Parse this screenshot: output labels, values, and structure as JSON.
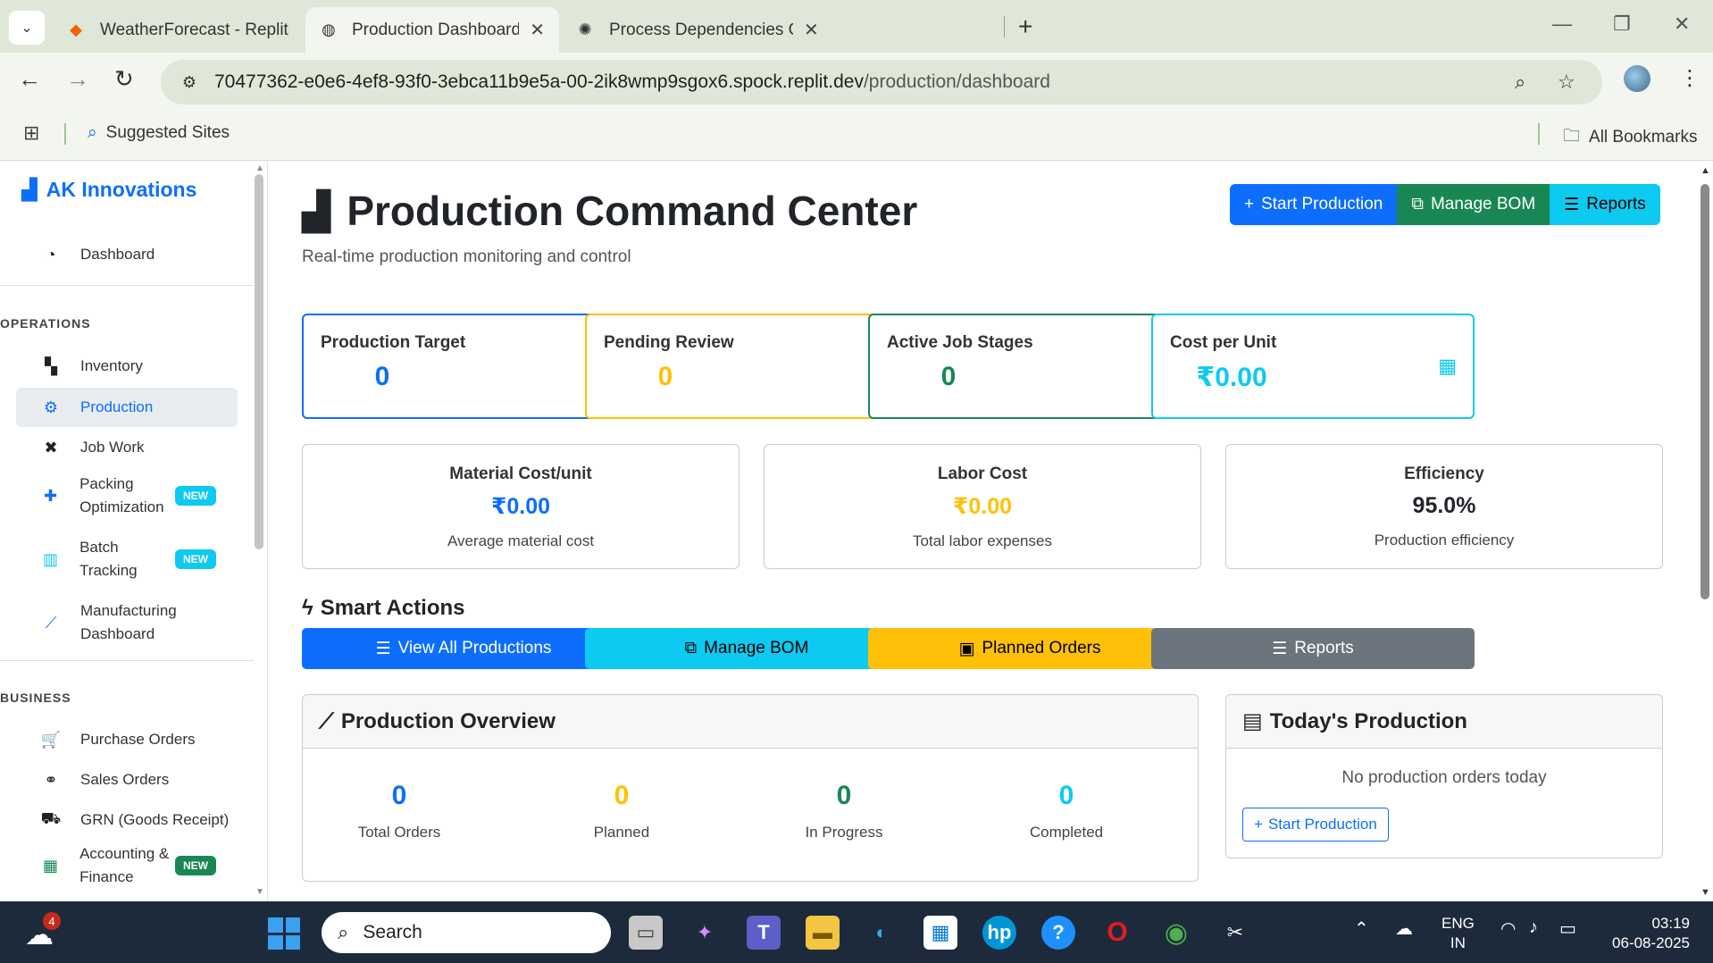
{
  "browser": {
    "tabs": [
      {
        "title": "WeatherForecast - Replit",
        "active": false
      },
      {
        "title": "Production Dashboard - Factory",
        "active": true
      },
      {
        "title": "Process Dependencies Overview",
        "active": false
      }
    ],
    "url_host": "70477362-e0e6-4ef8-93f0-3ebca11b9e5a-00-2ik8wmp9sgox6.spock.replit.dev",
    "url_path": "/production/dashboard",
    "bookmarks": {
      "suggested": "Suggested Sites",
      "all": "All Bookmarks"
    }
  },
  "sidebar": {
    "brand": "AK Innovations",
    "dashboard": "Dashboard",
    "section_operations": "OPERATIONS",
    "operations": [
      {
        "label": "Inventory",
        "icon": "cubes-icon"
      },
      {
        "label": "Production",
        "icon": "gears-icon",
        "active": true
      },
      {
        "label": "Job Work",
        "icon": "tools-icon"
      },
      {
        "label": "Packing Optimization",
        "icon": "puzzle-icon",
        "badge": "NEW"
      },
      {
        "label": "Batch Tracking",
        "icon": "barcode-icon",
        "badge": "NEW"
      },
      {
        "label": "Manufacturing Dashboard",
        "icon": "chart-line-icon"
      }
    ],
    "section_business": "BUSINESS",
    "business": [
      {
        "label": "Purchase Orders",
        "icon": "cart-icon"
      },
      {
        "label": "Sales Orders",
        "icon": "handshake-icon"
      },
      {
        "label": "GRN (Goods Receipt)",
        "icon": "truck-icon"
      },
      {
        "label": "Accounting & Finance",
        "icon": "calculator-icon",
        "badge": "NEW"
      }
    ]
  },
  "header": {
    "title": "Production Command Center",
    "subtitle": "Real-time production monitoring and control",
    "buttons": {
      "start": "Start Production",
      "bom": "Manage BOM",
      "reports": "Reports"
    }
  },
  "stats": [
    {
      "label": "Production Target",
      "value": "0",
      "color": "#0d6efd"
    },
    {
      "label": "Pending Review",
      "value": "0",
      "color": "#ffc107"
    },
    {
      "label": "Active Job Stages",
      "value": "0",
      "color": "#198754"
    },
    {
      "label": "Cost per Unit",
      "value": "₹0.00",
      "color": "#0dcaf0"
    }
  ],
  "costs": [
    {
      "label": "Material Cost/unit",
      "value": "₹0.00",
      "desc": "Average material cost",
      "color": "#0d6efd"
    },
    {
      "label": "Labor Cost",
      "value": "₹0.00",
      "desc": "Total labor expenses",
      "color": "#ffc107"
    },
    {
      "label": "Efficiency",
      "value": "95.0%",
      "desc": "Production efficiency",
      "color": "#212529"
    }
  ],
  "smart_actions": {
    "title": "Smart Actions",
    "buttons": [
      "View All Productions",
      "Manage BOM",
      "Planned Orders",
      "Reports"
    ]
  },
  "overview": {
    "title": "Production Overview",
    "stats": [
      {
        "value": "0",
        "label": "Total Orders",
        "color": "#0d6efd"
      },
      {
        "value": "0",
        "label": "Planned",
        "color": "#ffc107"
      },
      {
        "value": "0",
        "label": "In Progress",
        "color": "#198754"
      },
      {
        "value": "0",
        "label": "Completed",
        "color": "#0dcaf0"
      }
    ]
  },
  "today": {
    "title": "Today's Production",
    "empty": "No production orders today",
    "button": "Start Production"
  },
  "taskbar": {
    "search": "Search",
    "weather_badge": "4",
    "lang": "ENG",
    "region": "IN",
    "time": "03:19",
    "date": "06-08-2025"
  }
}
